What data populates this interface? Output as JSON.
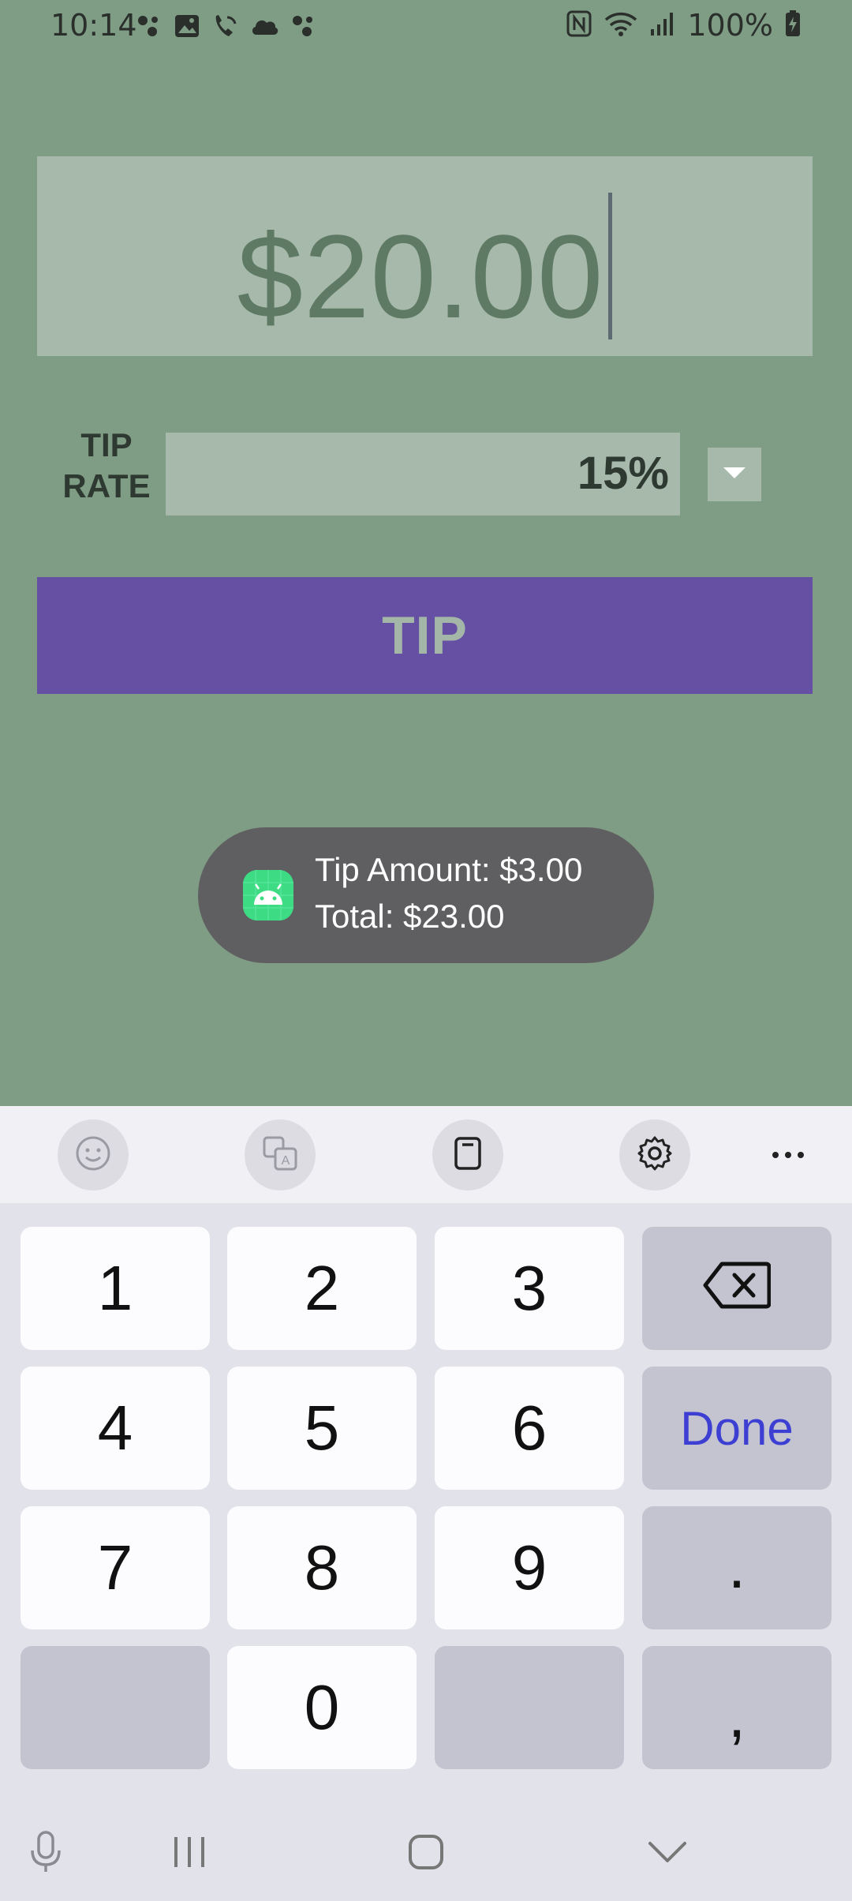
{
  "status_bar": {
    "time": "10:14",
    "battery": "100%",
    "left_icons": [
      "assistant-dots-icon",
      "gallery-icon",
      "wifi-call-icon",
      "cloud-icon",
      "assistant-dots-icon"
    ],
    "right_icons": [
      "nfc-icon",
      "wifi-icon",
      "signal-icon",
      "battery-charging-icon"
    ]
  },
  "amount": {
    "value": "$20.00"
  },
  "tip_rate": {
    "label_line1": "TIP",
    "label_line2": "RATE",
    "value": "15%"
  },
  "tip_button": {
    "label": "TIP"
  },
  "toast": {
    "line1": "Tip Amount: $3.00",
    "line2": "Total: $23.00"
  },
  "keyboard": {
    "toolbar": [
      "emoji-icon",
      "translate-icon",
      "clipboard-icon",
      "settings-gear-icon",
      "more-icon"
    ],
    "keys": {
      "k1": "1",
      "k2": "2",
      "k3": "3",
      "k4": "4",
      "k5": "5",
      "k6": "6",
      "k7": "7",
      "k8": "8",
      "k9": "9",
      "k0": "0",
      "done": "Done",
      "dot": ".",
      "comma": ","
    }
  },
  "colors": {
    "background": "#7f9c85",
    "field": "#a6b9aa",
    "button": "#6650a4",
    "toast": "#5f5f61",
    "done_text": "#3d3fd3"
  }
}
